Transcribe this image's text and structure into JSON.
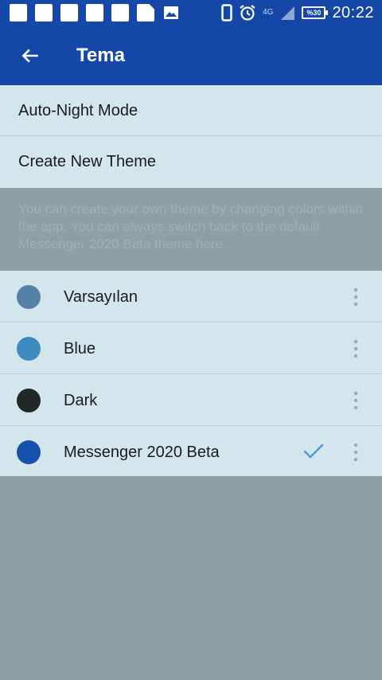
{
  "status_bar": {
    "clock": "20:22",
    "battery_level": "%30",
    "network": "4G"
  },
  "app_bar": {
    "title": "Tema"
  },
  "menu": {
    "auto_night_mode": "Auto-Night Mode",
    "create_new_theme": "Create New Theme"
  },
  "info": {
    "text": "You can create your own theme by changing colors within the app. You can always switch back to the default Messenger 2020 Beta theme here."
  },
  "themes": [
    {
      "name": "Varsayılan",
      "color": "#5580a8",
      "selected": false
    },
    {
      "name": "Blue",
      "color": "#3e8ac2",
      "selected": false
    },
    {
      "name": "Dark",
      "color": "#22272a",
      "selected": false
    },
    {
      "name": "Messenger 2020 Beta",
      "color": "#1651b0",
      "selected": true
    }
  ],
  "colors": {
    "primary": "#1447a8",
    "row_background": "#d3e6ec",
    "page_background": "#8fa0a4",
    "check": "#4a9ce0"
  }
}
